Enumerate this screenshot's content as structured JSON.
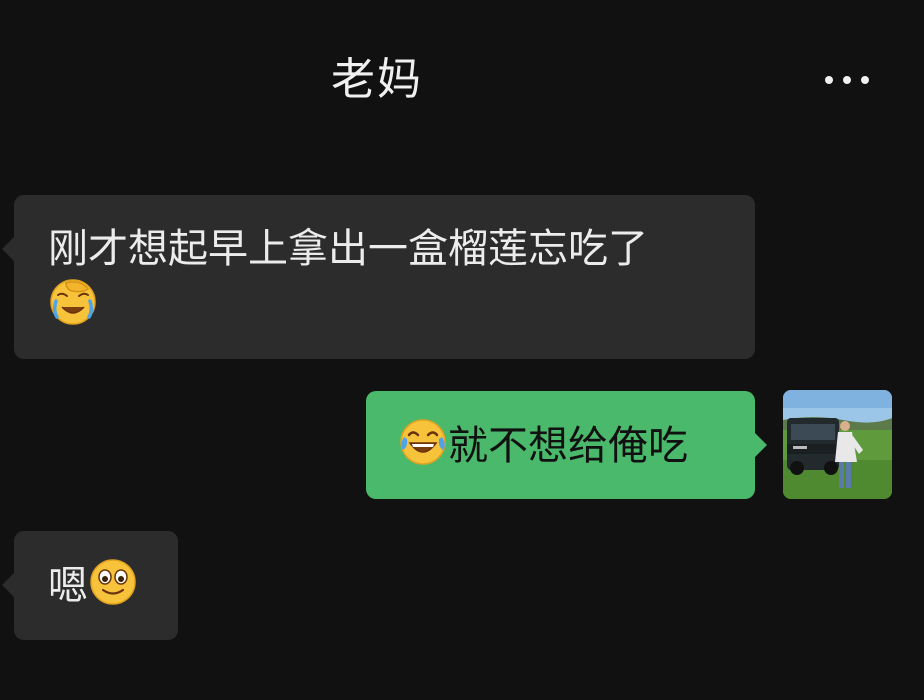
{
  "header": {
    "title": "老妈",
    "more_icon": "more-dots-icon"
  },
  "messages": [
    {
      "direction": "received",
      "text": "刚才想起早上拿出一盒榴莲忘吃了",
      "emoji": "face-palm-crying-icon"
    },
    {
      "direction": "sent",
      "emoji": "tears-of-joy-icon",
      "text": "就不想给俺吃"
    },
    {
      "direction": "received",
      "text": "嗯",
      "emoji": "smiling-face-icon"
    }
  ],
  "colors": {
    "background": "#111111",
    "received_bubble": "#2c2c2c",
    "sent_bubble": "#4bb96c"
  }
}
